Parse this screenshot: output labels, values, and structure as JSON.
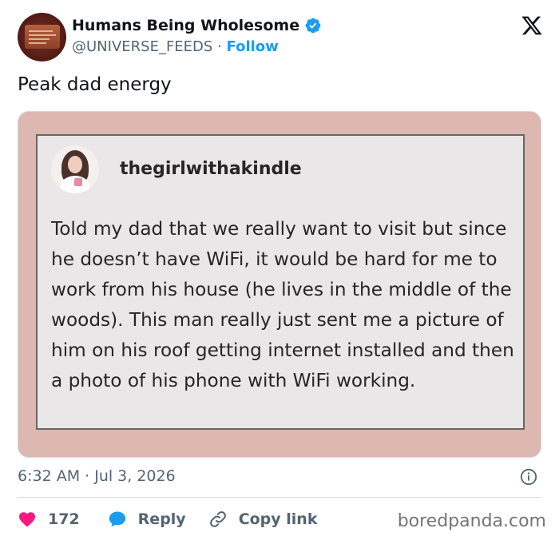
{
  "author": {
    "display_name": "Humans Being Wholesome",
    "handle": "@UNIVERSE_FEEDS",
    "separator": "·",
    "follow_label": "Follow",
    "verified_color": "#1d9bf0",
    "avatar_icon": "plaque-avatar"
  },
  "tweet": {
    "text": "Peak dad energy",
    "timestamp": "6:32 AM · Jul 3, 2026"
  },
  "embedded_post": {
    "username": "thegirlwithakindle",
    "avatar_icon": "profile-photo",
    "body": "Told my dad that we really want to visit but since he doesn’t have WiFi, it would be hard for me to work from his house (he lives in the middle of the woods). This man really just sent me a picture of him on his roof getting internet installed and then a photo of his phone with WiFi working.",
    "frame_color": "#dcb8b1"
  },
  "actions": {
    "like_count": "172",
    "reply_label": "Reply",
    "copy_label": "Copy link",
    "heart_color": "#f91880",
    "reply_color": "#1d9bf0",
    "icons": [
      "heart-icon",
      "reply-bubble-icon",
      "link-icon",
      "info-icon",
      "x-logo-icon"
    ]
  },
  "watermark": "boredpanda.com"
}
